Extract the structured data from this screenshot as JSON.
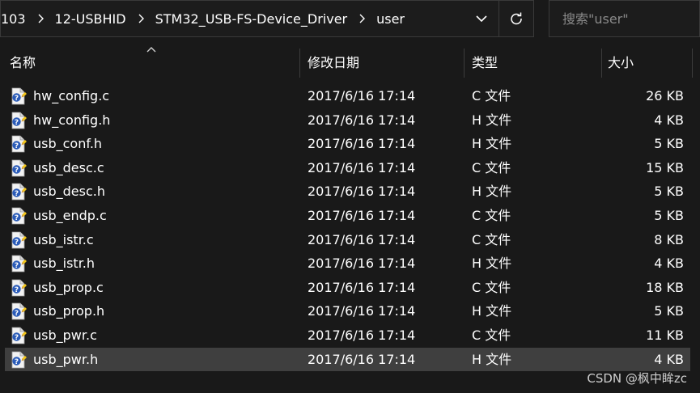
{
  "breadcrumb": {
    "items": [
      "103",
      "12-USBHID",
      "STM32_USB-FS-Device_Driver",
      "user"
    ]
  },
  "search": {
    "placeholder": "搜索\"user\""
  },
  "columns": {
    "name": "名称",
    "modified": "修改日期",
    "type": "类型",
    "size": "大小"
  },
  "files": [
    {
      "name": "hw_config.c",
      "modified": "2017/6/16 17:14",
      "type": "C 文件",
      "size": "26 KB"
    },
    {
      "name": "hw_config.h",
      "modified": "2017/6/16 17:14",
      "type": "H 文件",
      "size": "4 KB"
    },
    {
      "name": "usb_conf.h",
      "modified": "2017/6/16 17:14",
      "type": "H 文件",
      "size": "5 KB"
    },
    {
      "name": "usb_desc.c",
      "modified": "2017/6/16 17:14",
      "type": "C 文件",
      "size": "15 KB"
    },
    {
      "name": "usb_desc.h",
      "modified": "2017/6/16 17:14",
      "type": "H 文件",
      "size": "5 KB"
    },
    {
      "name": "usb_endp.c",
      "modified": "2017/6/16 17:14",
      "type": "C 文件",
      "size": "5 KB"
    },
    {
      "name": "usb_istr.c",
      "modified": "2017/6/16 17:14",
      "type": "C 文件",
      "size": "8 KB"
    },
    {
      "name": "usb_istr.h",
      "modified": "2017/6/16 17:14",
      "type": "H 文件",
      "size": "4 KB"
    },
    {
      "name": "usb_prop.c",
      "modified": "2017/6/16 17:14",
      "type": "C 文件",
      "size": "18 KB"
    },
    {
      "name": "usb_prop.h",
      "modified": "2017/6/16 17:14",
      "type": "H 文件",
      "size": "5 KB"
    },
    {
      "name": "usb_pwr.c",
      "modified": "2017/6/16 17:14",
      "type": "C 文件",
      "size": "11 KB"
    },
    {
      "name": "usb_pwr.h",
      "modified": "2017/6/16 17:14",
      "type": "H 文件",
      "size": "4 KB",
      "selected": true
    }
  ],
  "watermark": "CSDN @枫中眸zc",
  "icons": {
    "breadcrumb_separator": "chevron-right-icon",
    "history_dropdown": "chevron-down-icon",
    "refresh": "refresh-icon",
    "sort": "sort-ascending-icon",
    "file": "unknown-file-icon"
  },
  "colors": {
    "background": "#191919",
    "selected_row": "#3f3f3f",
    "text": "#ffffff"
  }
}
